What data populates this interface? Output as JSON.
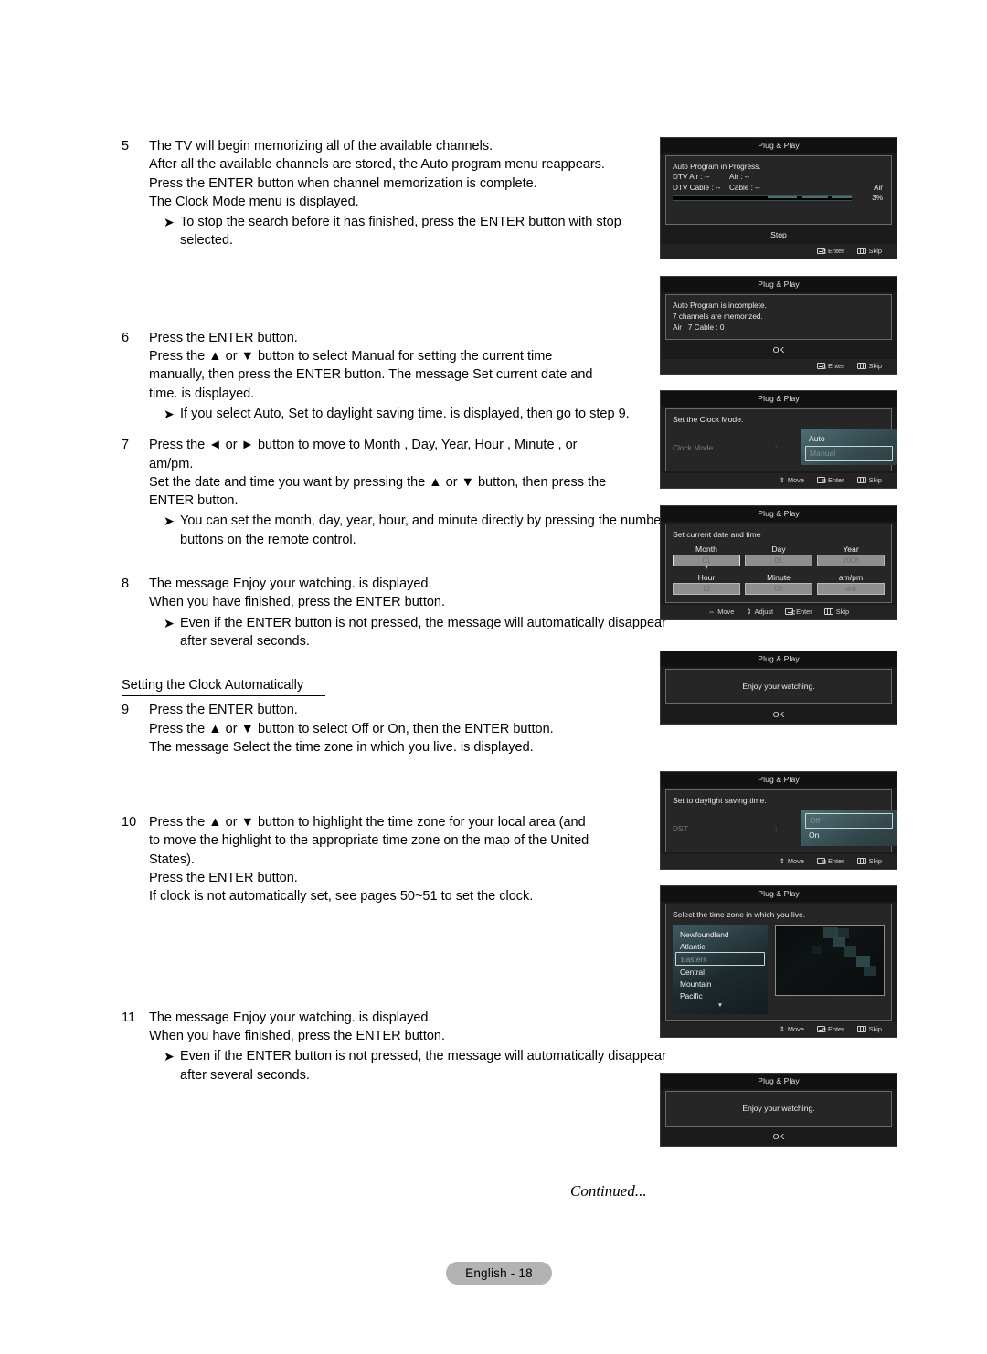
{
  "document": {
    "page_label": "English - 18",
    "continued_label": "Continued...",
    "section_heading": "Setting the Clock Automatically"
  },
  "steps": [
    {
      "number": "5",
      "lines": [
        "The TV will begin memorizing all of the available channels.",
        "After all the available channels are stored, the Auto program menu reappears.",
        "Press the ENTER button when channel memorization is complete.",
        "The Clock Mode  menu is displayed."
      ],
      "bullets": [
        "To stop the search before it has finished, press the ENTER button with stop selected."
      ]
    },
    {
      "number": "6",
      "lines": [
        "Press the ENTER button.",
        "Press the ▲ or ▼ button to select Manual  for setting the current time",
        "manually, then press the ENTER button. The message Set current date and",
        "time. is displayed."
      ],
      "bullets": [
        "If you select Auto, Set to daylight saving time.    is displayed, then go to step 9."
      ]
    },
    {
      "number": "7",
      "lines": [
        "Press the ◄ or ► button to move to Month , Day, Year, Hour , Minute , or",
        "am/pm.",
        "Set the date and time you want by pressing the ▲ or ▼ button, then press the",
        "ENTER button."
      ],
      "bullets": [
        "You can set the month, day, year, hour, and minute directly by pressing the number buttons on the remote control."
      ]
    },
    {
      "number": "8",
      "lines": [
        "The message Enjoy your watching.    is displayed.",
        "When you have finished, press the ENTER button."
      ],
      "bullets": [
        "Even if the ENTER button is not pressed, the message will automatically disappear after several seconds."
      ]
    },
    {
      "number": "9",
      "lines": [
        "Press the ENTER button.",
        "Press the ▲ or ▼ button to select Off  or On, then the ENTER button.",
        "The message Select the time zone in which you live.     is displayed."
      ],
      "bullets": []
    },
    {
      "number": "10",
      "lines": [
        "Press the ▲ or ▼ button to highlight the time zone for your local area (and",
        "to move the highlight to the appropriate time zone on the map of the United",
        "States).",
        "Press the ENTER button.",
        "If clock is not automatically set, see pages 50~51 to set the clock."
      ],
      "bullets": []
    },
    {
      "number": "11",
      "lines": [
        "The message Enjoy your watching.    is displayed.",
        "When you have finished, press the ENTER button."
      ],
      "bullets": [
        "Even if the ENTER button is not pressed, the message will automatically disappear after several seconds."
      ]
    }
  ],
  "osd": {
    "title": "Plug & Play",
    "footer": {
      "move": "Move",
      "adjust": "Adjust",
      "enter": "Enter",
      "skip": "Skip"
    },
    "panel_progress": {
      "heading": "Auto Program in Progress.",
      "rows": [
        {
          "c1": "DTV Air : --",
          "c2": "Air : --"
        },
        {
          "c1": "DTV Cable : --",
          "c2": "Cable : --"
        }
      ],
      "band_label": "Air",
      "percent": "3%",
      "action": "Stop"
    },
    "panel_incomplete": {
      "line1": "Auto Program is incomplete.",
      "line2": "7 channels are memorized.",
      "line3": "Air : 7     Cable : 0",
      "action": "OK"
    },
    "panel_clock_mode": {
      "heading": "Set the Clock Mode.",
      "setting_label": "Clock Mode",
      "options": [
        "Auto",
        "Manual"
      ],
      "selected": "Manual"
    },
    "panel_datetime": {
      "heading": "Set current date and time",
      "fields": [
        {
          "label": "Month",
          "value": "01",
          "focused": true
        },
        {
          "label": "Day",
          "value": "01",
          "focused": false
        },
        {
          "label": "Year",
          "value": "2008",
          "focused": false
        },
        {
          "label": "Hour",
          "value": "12",
          "focused": false
        },
        {
          "label": "Minute",
          "value": "00",
          "focused": false
        },
        {
          "label": "am/pm",
          "value": "am",
          "focused": false
        }
      ]
    },
    "panel_enjoy": {
      "message": "Enjoy your watching.",
      "action": "OK"
    },
    "panel_dst": {
      "heading": "Set to daylight saving time.",
      "setting_label": "DST",
      "options": [
        "Off",
        "On"
      ],
      "selected": "Off"
    },
    "panel_timezone": {
      "heading": "Select the time zone in which you live.",
      "zones": [
        "Newfoundland",
        "Atlantic",
        "Eastern",
        "Central",
        "Mountain",
        "Pacific"
      ],
      "selected": "Eastern",
      "scroll_indicator": "▼"
    },
    "panel_enjoy2": {
      "message": "Enjoy your watching.",
      "action": "OK"
    }
  },
  "colors": {
    "osd_bg": "#1b1b1b",
    "osd_body": "#262626",
    "osd_text": "#e8e8e8",
    "accent_teal": "#4d6f70",
    "badge_gray": "#b3b3b3"
  }
}
